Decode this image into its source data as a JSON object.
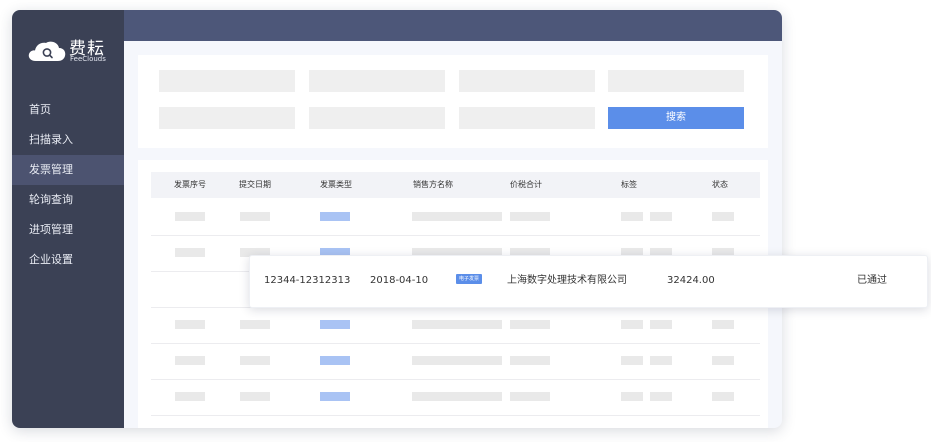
{
  "brand": {
    "name_cn": "费耘",
    "name_en": "FeeClouds"
  },
  "sidebar": {
    "items": [
      {
        "label": "首页"
      },
      {
        "label": "扫描录入"
      },
      {
        "label": "发票管理",
        "active": true
      },
      {
        "label": "轮询查询"
      },
      {
        "label": "进项管理"
      },
      {
        "label": "企业设置"
      }
    ]
  },
  "filters": {
    "search_label": "搜索"
  },
  "table": {
    "columns": [
      "发票序号",
      "提交日期",
      "发票类型",
      "销售方名称",
      "价税合计",
      "标签",
      "状态"
    ]
  },
  "highlight_row": {
    "invoice_no": "12344-12312313",
    "date": "2018-04-10",
    "type_tag": "电子发票",
    "seller": "上海数字处理技术有限公司",
    "amount": "32424.00",
    "status": "已通过"
  },
  "colors": {
    "sidebar": "#3b4155",
    "topbar": "#4d5779",
    "accent": "#5b8ee9"
  }
}
